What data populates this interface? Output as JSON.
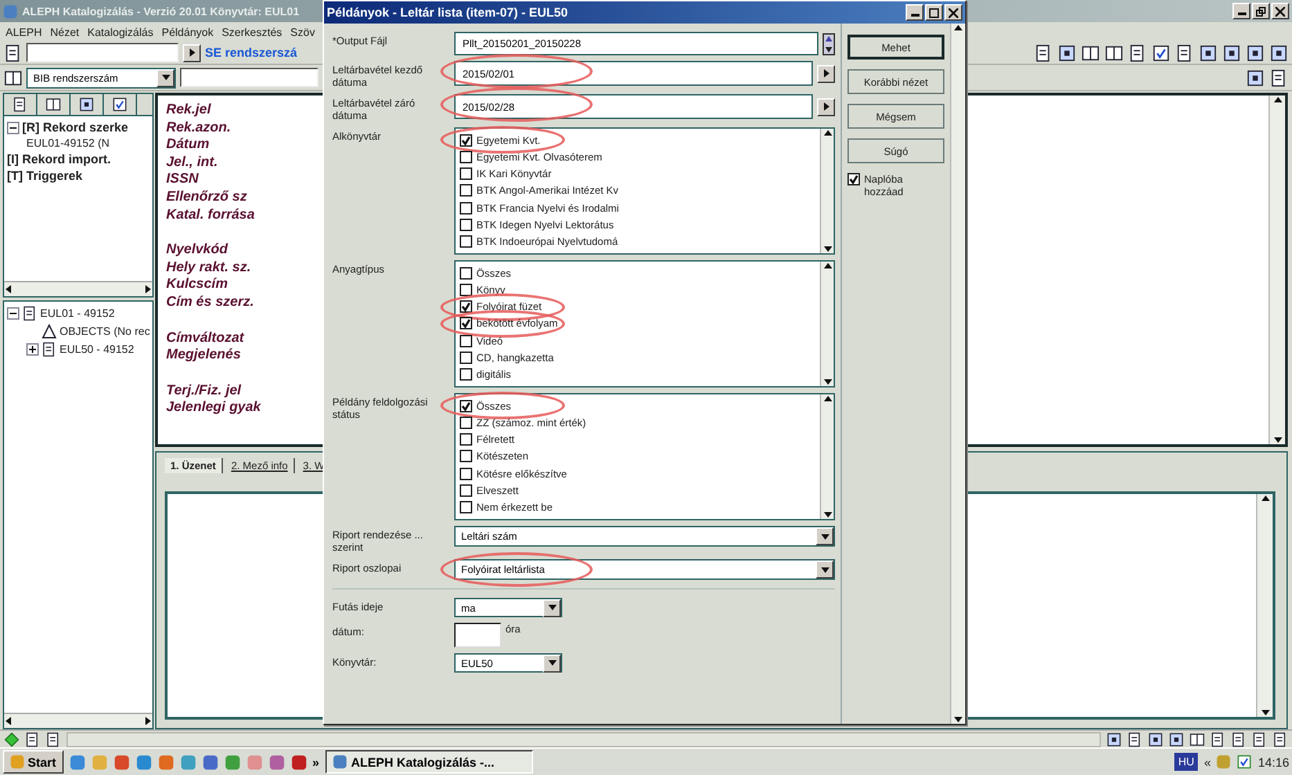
{
  "main_window": {
    "title": "ALEPH Katalogizálás - Verzió 20.01  Könyvtár: EUL01",
    "menu": [
      "ALEPH",
      "Nézet",
      "Katalogizálás",
      "Példányok",
      "Szerkesztés",
      "Szöv"
    ],
    "toolbar": {
      "search_label": "SE rendszerszá",
      "index_select": "BIB rendszerszám"
    },
    "nav_tree": [
      {
        "label": "[R] Rekord szerke",
        "expanded": true,
        "children": [
          {
            "label": "EUL01-49152 (N"
          }
        ]
      },
      {
        "label": "[I] Rekord import."
      },
      {
        "label": "[T] Triggerek"
      }
    ],
    "record_tree": [
      {
        "label": "EUL01 - 49152",
        "kind": "record",
        "expanded": true,
        "children": [
          {
            "label": "OBJECTS (No rec",
            "kind": "objects"
          },
          {
            "label": "EUL50 - 49152",
            "kind": "record",
            "expanded": false
          }
        ]
      }
    ],
    "editor_groups": [
      [
        "Rek.jel",
        "Rek.azon.",
        "Dátum",
        "Jel., int.",
        "ISSN",
        "Ellenőrző sz",
        "Katal. forrása"
      ],
      [
        "Nyelvkód",
        "Hely rakt. sz.",
        "Kulcscím",
        "Cím és szerz."
      ],
      [
        "Címváltozat",
        "Megjelenés"
      ],
      [
        "Terj./Fiz. jel",
        "Jelenlegi gyak"
      ]
    ],
    "message_tabs": [
      {
        "label": "1. Üzenet",
        "selected": true
      },
      {
        "label": "2. Mező info",
        "selected": false
      },
      {
        "label": "3. W",
        "selected": false
      }
    ]
  },
  "dialog": {
    "title": "Példányok - Leltár lista (item-07) - EUL50",
    "sections": [
      {
        "fields": [
          {
            "kind": "file",
            "label": "*Output Fájl",
            "value": "Pllt_20150201_20150228",
            "highlighted": false
          },
          {
            "kind": "date",
            "label": "Leltárbavétel kezdő dátuma",
            "value": "2015/02/01",
            "highlighted": true
          },
          {
            "kind": "date",
            "label": "Leltárbavétel záró dátuma",
            "value": "2015/02/28",
            "highlighted": true
          },
          {
            "kind": "checklist",
            "label": "Alkönyvtár",
            "items": [
              {
                "label": "Egyetemi Kvt.",
                "checked": true,
                "highlighted": true
              },
              {
                "label": "Egyetemi Kvt. Olvasóterem",
                "checked": false,
                "highlighted": false
              },
              {
                "label": "IK Kari Könyvtár",
                "checked": false,
                "highlighted": false
              },
              {
                "label": "BTK Angol-Amerikai Intézet Kv",
                "checked": false,
                "highlighted": false
              },
              {
                "label": "BTK Francia Nyelvi és Irodalmi",
                "checked": false,
                "highlighted": false
              },
              {
                "label": "BTK Idegen Nyelvi Lektorátus",
                "checked": false,
                "highlighted": false
              },
              {
                "label": "BTK Indoeurópai Nyelvtudomá",
                "checked": false,
                "highlighted": false
              }
            ]
          },
          {
            "kind": "checklist",
            "label": "Anyagtípus",
            "items": [
              {
                "label": "Összes",
                "checked": false,
                "highlighted": false
              },
              {
                "label": "Könyv",
                "checked": false,
                "highlighted": false
              },
              {
                "label": "Folyóirat füzet",
                "checked": true,
                "highlighted": true
              },
              {
                "label": "bekötött évfolyam",
                "checked": true,
                "highlighted": true
              },
              {
                "label": "Videó",
                "checked": false,
                "highlighted": false
              },
              {
                "label": "CD, hangkazetta",
                "checked": false,
                "highlighted": false
              },
              {
                "label": "digitális",
                "checked": false,
                "highlighted": false
              }
            ]
          },
          {
            "kind": "checklist",
            "label": "Példány feldolgozási státus",
            "items": [
              {
                "label": "Összes",
                "checked": true,
                "highlighted": true
              },
              {
                "label": "ZZ (számoz. mint érték)",
                "checked": false,
                "highlighted": false
              },
              {
                "label": "Félretett",
                "checked": false,
                "highlighted": false
              },
              {
                "label": "Kötészeten",
                "checked": false,
                "highlighted": false
              },
              {
                "label": "Kötésre előkészítve",
                "checked": false,
                "highlighted": false
              },
              {
                "label": "Elveszett",
                "checked": false,
                "highlighted": false
              },
              {
                "label": "Nem érkezett be",
                "checked": false,
                "highlighted": false
              }
            ]
          },
          {
            "kind": "select",
            "label": "Riport rendezése ... szerint",
            "value": "Leltári szám",
            "highlighted": false
          },
          {
            "kind": "select",
            "label": "Riport oszlopai",
            "value": "Folyóirat leltárlista",
            "highlighted": true
          }
        ]
      },
      {
        "fields": [
          {
            "kind": "small_select",
            "label": "Futás ideje",
            "value": "ma"
          },
          {
            "kind": "time",
            "label": "dátum:",
            "suffix": "óra"
          },
          {
            "kind": "small_select",
            "label": "Könyvtár:",
            "value": "EUL50"
          }
        ]
      }
    ],
    "buttons": [
      {
        "label": "Mehet",
        "default": true
      },
      {
        "label": "Korábbi nézet",
        "default": false
      },
      {
        "label": "Mégsem",
        "default": false
      },
      {
        "label": "Súgó",
        "default": false
      }
    ],
    "log_option": {
      "label": "Naplóba hozzáad",
      "checked": true
    }
  },
  "taskbar": {
    "start": "Start",
    "more": "»",
    "task": "ALEPH Katalogizálás -...",
    "language": "HU",
    "tray_expand": "«",
    "clock": "14:16"
  }
}
